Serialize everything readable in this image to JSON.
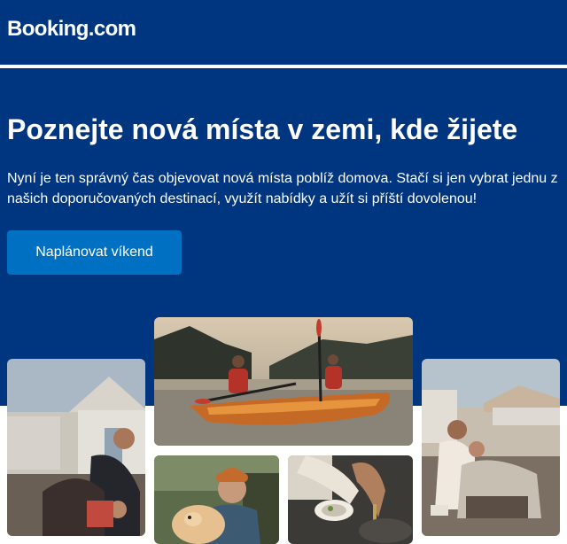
{
  "header": {
    "logo_text": "Booking.com"
  },
  "hero": {
    "headline": "Poznejte nová místa v zemi, kde žijete",
    "body": "Nyní je ten správný čas objevovat nová místa poblíž domova. Stačí si jen vybrat jednu z našich doporučovaných destinací, využít nabídky a užít si příští dovolenou!",
    "cta_label": "Naplánovat víkend"
  },
  "colors": {
    "brand_dark_blue": "#003580",
    "button_blue": "#0071c2",
    "text_white": "#ffffff"
  }
}
